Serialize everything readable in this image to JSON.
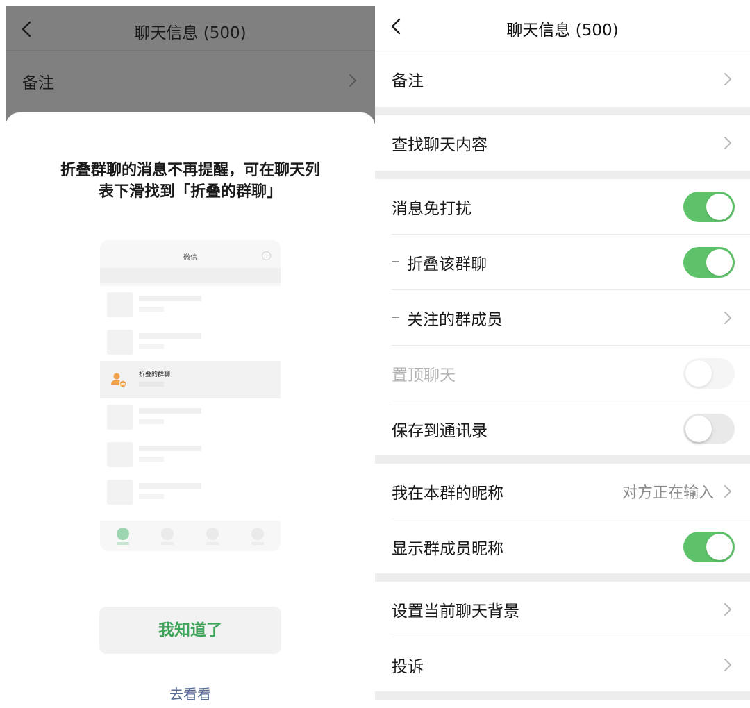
{
  "left": {
    "background_header": {
      "title": "聊天信息 (500)",
      "row_label": "备注"
    },
    "sheet": {
      "message_line1": "折叠群聊的消息不再提醒，可在聊天列",
      "message_line2": "表下滑找到「折叠的群聊」",
      "mockup": {
        "title": "微信",
        "folded_item_name": "折叠的群聊"
      },
      "primary_button": "我知道了",
      "secondary_link": "去看看"
    }
  },
  "right": {
    "header": {
      "title": "聊天信息 (500)"
    },
    "rows": {
      "remark": "备注",
      "search_history": "查找聊天内容",
      "mute": {
        "label": "消息免打扰",
        "on": true
      },
      "fold_group": {
        "label": "折叠该群聊",
        "on": true
      },
      "followed_members": "关注的群成员",
      "sticky_on_top": {
        "label": "置顶聊天",
        "on": false,
        "disabled": true
      },
      "save_to_contacts": {
        "label": "保存到通讯录",
        "on": false
      },
      "my_alias": {
        "label": "我在本群的昵称",
        "value": "对方正在输入"
      },
      "show_member_names": {
        "label": "显示群成员昵称",
        "on": true
      },
      "set_background": "设置当前聊天背景",
      "complain": "投诉"
    }
  },
  "colors": {
    "toggle_on": "#5ec26a",
    "primary_button_text": "#3fa45a",
    "link": "#576b95",
    "group_gap": "#ededed"
  }
}
